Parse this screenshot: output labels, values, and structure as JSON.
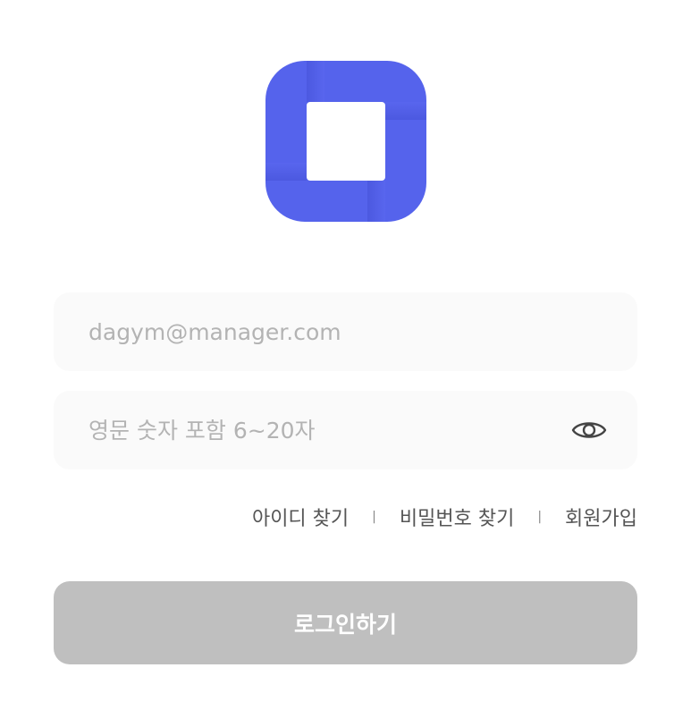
{
  "brand": {
    "logo_icon": "square-ring-logo-icon",
    "color": "#5563EC"
  },
  "form": {
    "email_placeholder": "dagym@manager.com",
    "email_value": "",
    "password_placeholder": "영문 숫자 포함 6~20자",
    "password_value": "",
    "toggle_icon": "eye-icon"
  },
  "links": {
    "find_id": "아이디 찾기",
    "find_password": "비밀번호 찾기",
    "signup": "회원가입",
    "separator": "|"
  },
  "login_button": {
    "label": "로그인하기",
    "color": "#BFBFBF"
  }
}
